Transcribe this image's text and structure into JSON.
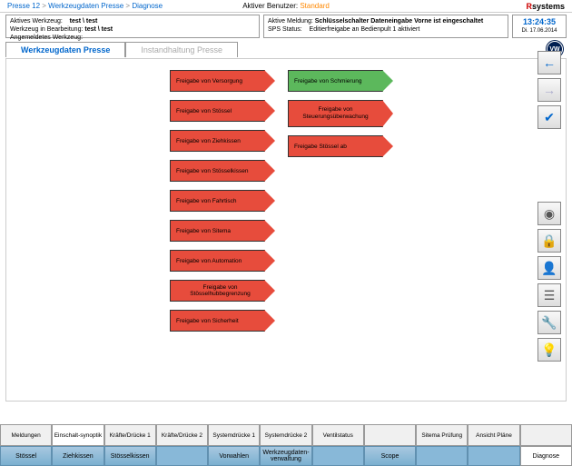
{
  "breadcrumb": {
    "p1": "Presse 12",
    "p2": "Werkzeugdaten Presse",
    "p3": "Diagnose"
  },
  "user": {
    "label": "Aktiver Benutzer:",
    "value": "Standard"
  },
  "logo": {
    "r": "R",
    "rest": "systems"
  },
  "info_left": {
    "l1a": "Aktives Werkzeug:",
    "l1b": "test \\ test",
    "l2a": "Werkzeug in Bearbeitung:",
    "l2b": "test \\ test",
    "l3a": "Angemeldetes Werkzeug:"
  },
  "info_mid": {
    "l1a": "Aktive Meldung:",
    "l1b": "Schlüsselschalter Dateneingabe Vorne ist eingeschaltet",
    "l2a": "SPS Status:",
    "l2b": "Editierfreigabe an Bedienpult 1 aktiviert"
  },
  "info_right": {
    "time": "13:24:35",
    "date": "Di. 17.06.2014"
  },
  "tabs": {
    "t1": "Werkzeugdaten Presse",
    "t2": "Instandhaltung Presse"
  },
  "vw": "VW",
  "col1": [
    "Freigabe von Versorgung",
    "Freigabe von Stössel",
    "Freigabe von Ziehkissen",
    "Freigabe von Stösselkissen",
    "Freigabe von Fahrtisch",
    "Freigabe von Sitema",
    "Freigabe von Automation",
    "Freigabe von Stösselhubbegrenzung",
    "Freigabe von Sicherheit"
  ],
  "col2": [
    {
      "text": "Freigabe von Schmierung",
      "color": "green"
    },
    {
      "text": "Freigabe von Steuerungsüberwachung",
      "color": "red",
      "tall": true
    },
    {
      "text": "Freigabe Stössel ab",
      "color": "red"
    }
  ],
  "side_upper": [
    {
      "name": "back-icon",
      "glyph": "←",
      "color": "#0066cc"
    },
    {
      "name": "forward-icon",
      "glyph": "→",
      "color": "#aac"
    },
    {
      "name": "check-icon",
      "glyph": "✔",
      "color": "#0066cc"
    }
  ],
  "side_lower": [
    {
      "name": "camera-icon",
      "glyph": "◉"
    },
    {
      "name": "lock-icon",
      "glyph": "🔒"
    },
    {
      "name": "user-icon",
      "glyph": "👤"
    },
    {
      "name": "list-icon",
      "glyph": "☰"
    },
    {
      "name": "wrench-icon",
      "glyph": "🔧"
    },
    {
      "name": "bulb-icon",
      "glyph": "💡"
    }
  ],
  "btabs": [
    "Meldungen",
    "Einschalt-synoptik",
    "Kräfte/Drücke 1",
    "Kräfte/Drücke 2",
    "Systemdrücke 1",
    "Systemdrücke 2",
    "Ventilstatus",
    "",
    "Sitema Prüfung",
    "Ansicht Pläne",
    ""
  ],
  "bnav": [
    "Stössel",
    "Ziehkissen",
    "Stösselkissen",
    "",
    "Vorwahlen",
    "Werkzeugdaten-verwaltung",
    "",
    "Scope",
    "",
    "",
    "Diagnose"
  ]
}
